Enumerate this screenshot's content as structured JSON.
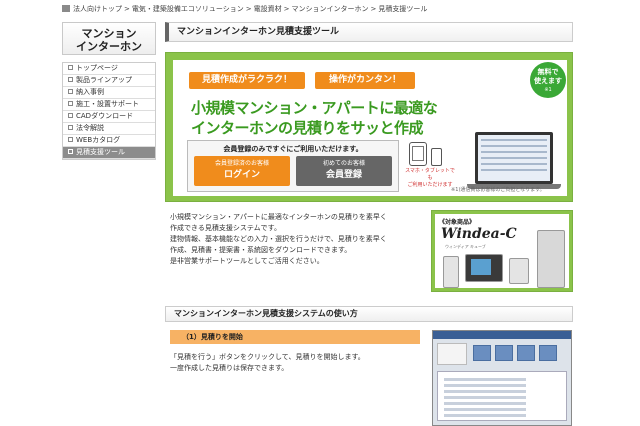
{
  "breadcrumb": [
    "法人向けトップ",
    ">",
    "電気・建築設備エコソリューション",
    ">",
    "電設資材",
    ">",
    "マンションインターホン",
    ">",
    "見積支援ツール"
  ],
  "sidebar": {
    "title_line1": "マンション",
    "title_line2": "インターホン",
    "items": [
      {
        "label": "トップページ",
        "active": false
      },
      {
        "label": "製品ラインアップ",
        "active": false
      },
      {
        "label": "納入事例",
        "active": false
      },
      {
        "label": "施工・設置サポート",
        "active": false
      },
      {
        "label": "CADダウンロード",
        "active": false
      },
      {
        "label": "法令解説",
        "active": false
      },
      {
        "label": "WEBカタログ",
        "active": false
      },
      {
        "label": "見積支援ツール",
        "active": true
      }
    ]
  },
  "page_title": "マンションインターホン見積支援ツール",
  "banner": {
    "pill_left": "見積作成がラクラク！",
    "pill_right": "操作がカンタン！",
    "headline_line1": "小規模マンション・アパートに最適な",
    "headline_line2": "インターホンの見積りをサッと作成",
    "member_message": "会員登録のみですぐにご利用いただけます。",
    "login_small": "会員登録済のお客様",
    "login_big": "ログイン",
    "register_small": "初めてのお客様",
    "register_big": "会員登録",
    "badge_line1": "無料で",
    "badge_line2": "使えます",
    "badge_note": "※1",
    "devices_caption_line1": "スマホ・タブレットでも",
    "devices_caption_line2": "ご利用いただけます",
    "footnote": "※1)通信費はお客様のご負担となります。",
    "colors": {
      "frame": "#8bc34a",
      "headline": "#3a9a20",
      "pill": "#f08c1c",
      "login": "#f08c1c",
      "register": "#666666"
    }
  },
  "intro": {
    "line1": "小規模マンション・アパートに最適なインターホンの見積りを素早く",
    "line2": "作成できる見積支援システムです。",
    "line3": "建物情報、基本機能などの入力・選択を行うだけで、見積りを素早く",
    "line4": "作成、見積書・提案書・系統図をダウンロードできます。",
    "line5": "是非営業サポートツールとしてご活用ください。"
  },
  "product": {
    "tag": "《対象商品》",
    "logo": "Windea-C",
    "logo_sub": "ウィンディア キューブ"
  },
  "usage": {
    "section_title": "マンションインターホン見積支援システムの使い方",
    "step1_title": "（1）見積りを開始",
    "step1_line1": "「見積を行う」ボタンをクリックして、見積りを開始します。",
    "step1_line2": "一度作成した見積りは保存できます。"
  }
}
